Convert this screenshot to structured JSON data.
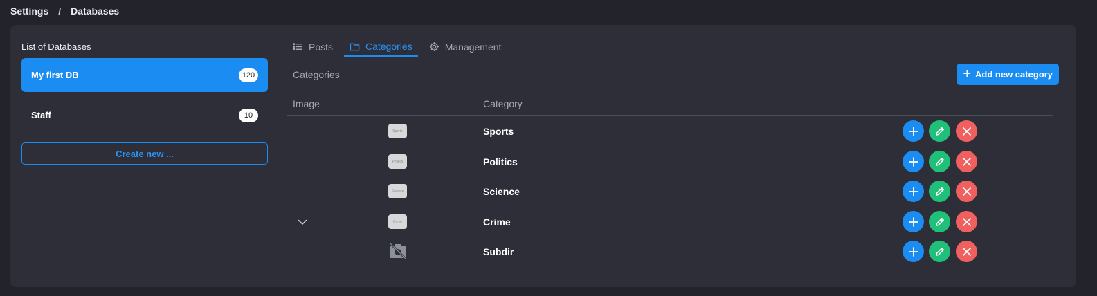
{
  "breadcrumb": {
    "items": [
      "Settings",
      "Databases"
    ],
    "separator": "/"
  },
  "sidebar": {
    "title": "List of Databases",
    "databases": [
      {
        "name": "My first DB",
        "count": "120",
        "active": true
      },
      {
        "name": "Staff",
        "count": "10",
        "active": false
      }
    ],
    "create_label": "Create new ..."
  },
  "tabs": [
    {
      "label": "Posts",
      "icon": "list-icon",
      "active": false
    },
    {
      "label": "Categories",
      "icon": "folder-icon",
      "active": true
    },
    {
      "label": "Management",
      "icon": "gear-icon",
      "active": false
    }
  ],
  "categories_section": {
    "title": "Categories",
    "add_button_label": "Add new category",
    "columns": {
      "image": "Image",
      "category": "Category"
    },
    "rows": [
      {
        "name": "Sports",
        "thumb": "Sports",
        "expandable": false,
        "broken_image": false
      },
      {
        "name": "Politics",
        "thumb": "Politics",
        "expandable": false,
        "broken_image": false
      },
      {
        "name": "Science",
        "thumb": "Science",
        "expandable": false,
        "broken_image": false
      },
      {
        "name": "Crime",
        "thumb": "Crime",
        "expandable": true,
        "broken_image": false
      },
      {
        "name": "Subdir",
        "thumb": "",
        "expandable": false,
        "broken_image": true
      }
    ]
  },
  "colors": {
    "background": "#22232b",
    "panel": "#2d2e38",
    "accent": "#1b8cf2",
    "edit": "#21c07a",
    "delete": "#f0605e"
  }
}
